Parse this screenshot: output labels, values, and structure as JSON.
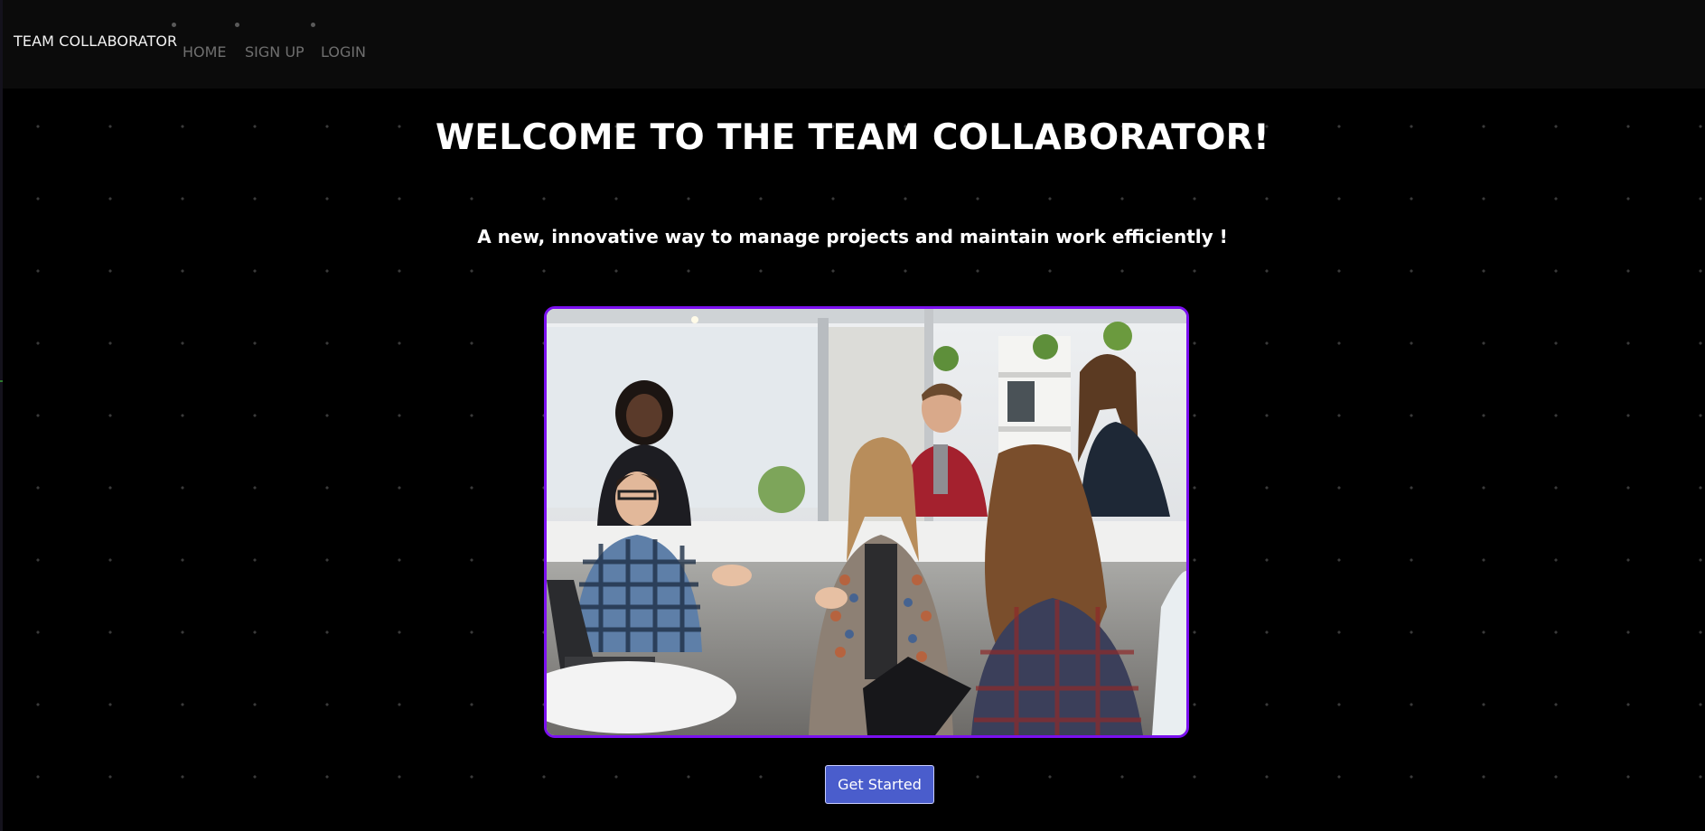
{
  "navbar": {
    "brand": "TEAM COLLABORATOR",
    "items": [
      {
        "label": "HOME"
      },
      {
        "label": "SIGN UP"
      },
      {
        "label": "LOGIN"
      }
    ]
  },
  "main": {
    "headline": "WELCOME TO THE TEAM COLLABORATOR!",
    "tagline": "A new, innovative way to manage projects and maintain work efficiently !",
    "cta_label": "Get Started"
  },
  "colors": {
    "background": "#000000",
    "navbar": "#0b0b0b",
    "frame_border": "#7b10f0",
    "button": "#4a5dcc",
    "nav_text": "#6f6f6f"
  }
}
